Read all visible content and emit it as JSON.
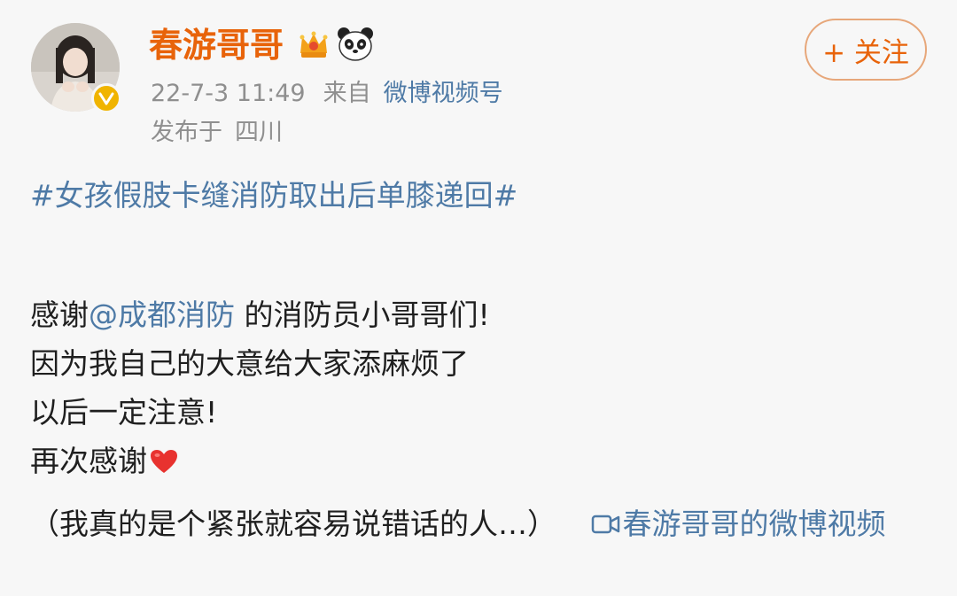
{
  "header": {
    "username": "春游哥哥",
    "date": "22-7-3 11:49",
    "source_prefix": "来自",
    "source": "微博视频号",
    "location_prefix": "发布于",
    "location": "四川",
    "follow_label": "+ 关注",
    "badges": [
      "crown-icon",
      "panda-icon",
      "verified-icon"
    ]
  },
  "post": {
    "hashtag": "#女孩假肢卡缝消防取出后单膝递回#",
    "line1_prefix": "感谢",
    "mention": "@成都消防",
    "line1_suffix": " 的消防员小哥哥们!",
    "line2": "因为我自己的大意给大家添麻烦了",
    "line3": "以后一定注意!",
    "line4": "再次感谢",
    "line5": "（我真的是个紧张就容易说错话的人…）",
    "video_link": "春游哥哥的微博视频"
  },
  "colors": {
    "username": "#e8630a",
    "link": "#4e7aa6",
    "meta": "#8f8f8f",
    "follow_border": "#e7a77a",
    "background": "#f7f7f7"
  }
}
